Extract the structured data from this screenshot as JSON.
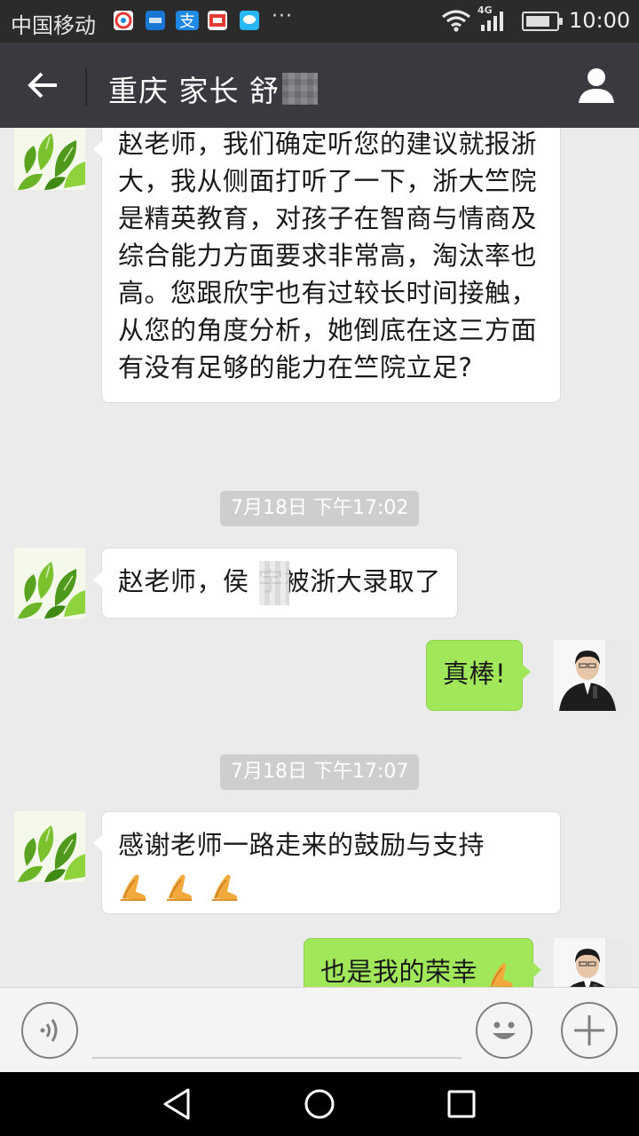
{
  "status_bar": {
    "carrier": "中国移动",
    "network": "4G",
    "time": "10:00",
    "notification_apps": [
      "camera-app-icon",
      "bank-app-icon",
      "alipay-icon",
      "weibo-news-icon",
      "message-app-icon"
    ],
    "battery_level": 0.8
  },
  "header": {
    "title": "重庆 家长 舒"
  },
  "messages": [
    {
      "text": "赵老师，我们确定听您的建议就报浙大，我从侧面打听了一下，浙大竺院是精英教育，对孩子在智商与情商及综合能力方面要求非常高，淘汰率也高。您跟欣宇也有过较长时间接触，从您的角度分析，她倒底在这三方面有没有足够的能力在竺院立足?"
    },
    {
      "timestamp": "7月18日 下午17:02"
    },
    {
      "text": "赵老师，侯 宇被浙大录取了"
    },
    {
      "text": "真棒!"
    },
    {
      "timestamp": "7月18日 下午17:07"
    },
    {
      "text": "感谢老师一路走来的鼓励与支持",
      "emoji": "folded-hands",
      "emoji_count": 3
    },
    {
      "text": "也是我的荣幸",
      "emoji": "folded-hands",
      "emoji_count": 1
    }
  ],
  "colors": {
    "status_bar_bg": "#2b2b2b",
    "title_bar_bg": "#393a3f",
    "chat_bg": "#ebebeb",
    "bubble_sent": "#a0e75a",
    "bubble_received": "#ffffff",
    "timestamp_bg": "#cecece"
  },
  "input_bar": {
    "placeholder": ""
  }
}
